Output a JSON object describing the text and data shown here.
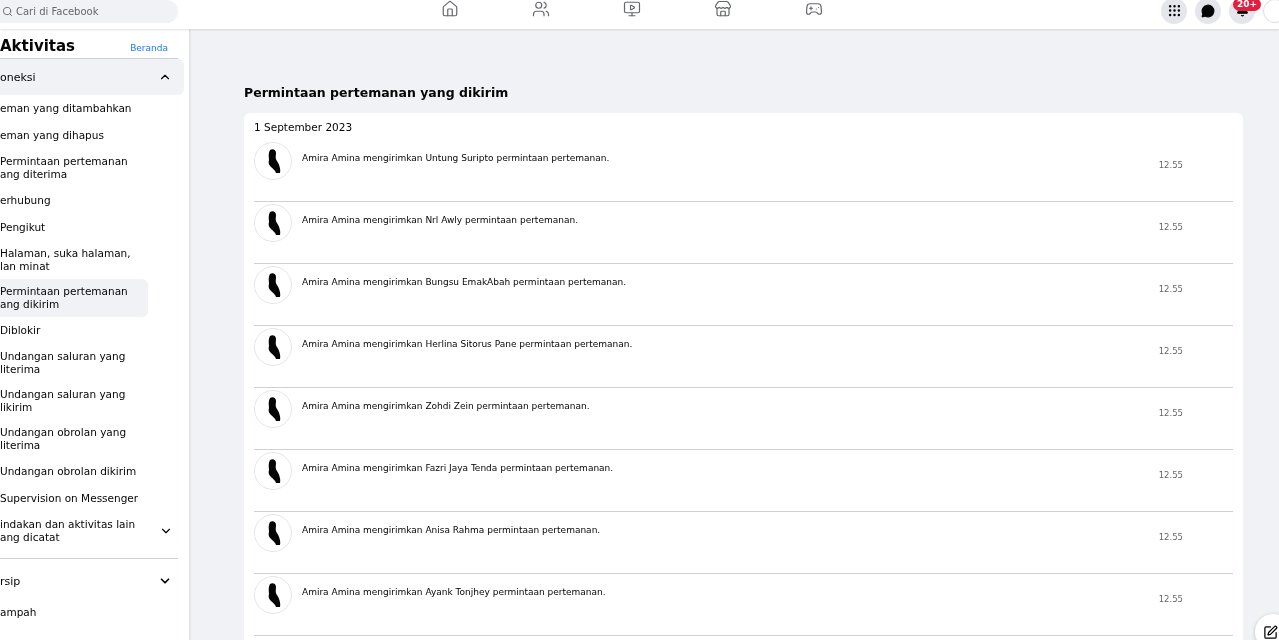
{
  "search": {
    "placeholder": "Cari di Facebook"
  },
  "nav_tabs": [
    {
      "selected": false
    },
    {
      "selected": false
    },
    {
      "selected": false
    },
    {
      "selected": false
    },
    {
      "selected": false
    }
  ],
  "notification_badge": "20+",
  "sidebar": {
    "title": "Aktivitas",
    "home_link": "Beranda",
    "section": {
      "label": "oneksi",
      "expanded": true
    },
    "items": [
      {
        "label": "eman yang ditambahkan",
        "selected": false,
        "kind": "link"
      },
      {
        "label": "eman yang dihapus",
        "selected": false,
        "kind": "link"
      },
      {
        "label": "Permintaan pertemanan\nang diterima",
        "selected": false,
        "kind": "link"
      },
      {
        "label": "erhubung",
        "selected": false,
        "kind": "link"
      },
      {
        "label": "Pengikut",
        "selected": false,
        "kind": "link"
      },
      {
        "label": "Halaman, suka halaman,\nlan minat",
        "selected": false,
        "kind": "link"
      },
      {
        "label": "Permintaan pertemanan\nang dikirim",
        "selected": true,
        "kind": "link"
      },
      {
        "label": "Diblokir",
        "selected": false,
        "kind": "link"
      },
      {
        "label": "Undangan saluran yang\nliterima",
        "selected": false,
        "kind": "link"
      },
      {
        "label": "Undangan saluran yang\nlikirim",
        "selected": false,
        "kind": "link"
      },
      {
        "label": "Undangan obrolan yang\nliterima",
        "selected": false,
        "kind": "link"
      },
      {
        "label": "Undangan obrolan dikirim",
        "selected": false,
        "kind": "link"
      },
      {
        "label": "Supervision on Messenger",
        "selected": false,
        "kind": "link"
      },
      {
        "label": "indakan dan aktivitas lain\nang dicatat",
        "selected": false,
        "kind": "group"
      }
    ],
    "archive": {
      "label": "rsip",
      "expanded": false
    },
    "trash": "ampah"
  },
  "page_title": "Permintaan pertemanan yang dikirim",
  "date": "1 September 2023",
  "rows": [
    {
      "actor": "Amira Amina",
      "verb": "mengirimkan",
      "target": "Untung Suripto",
      "rest": "permintaan pertemanan.",
      "time": "12.55"
    },
    {
      "actor": "Amira Amina",
      "verb": "mengirimkan",
      "target": "Nrl Awly",
      "rest": "permintaan pertemanan.",
      "time": "12.55"
    },
    {
      "actor": "Amira Amina",
      "verb": "mengirimkan",
      "target": "Bungsu EmakAbah",
      "rest": "permintaan pertemanan.",
      "time": "12.55"
    },
    {
      "actor": "Amira Amina",
      "verb": "mengirimkan",
      "target": "Herlina Sitorus Pane",
      "rest": "permintaan pertemanan.",
      "time": "12.55"
    },
    {
      "actor": "Amira Amina",
      "verb": "mengirimkan",
      "target": "Zohdi Zein",
      "rest": "permintaan pertemanan.",
      "time": "12.55"
    },
    {
      "actor": "Amira Amina",
      "verb": "mengirimkan",
      "target": "Fazri Jaya Tenda",
      "rest": "permintaan pertemanan.",
      "time": "12.55"
    },
    {
      "actor": "Amira Amina",
      "verb": "mengirimkan",
      "target": "Anisa Rahma",
      "rest": "permintaan pertemanan.",
      "time": "12.55"
    },
    {
      "actor": "Amira Amina",
      "verb": "mengirimkan",
      "target": "Ayank Tonjhey",
      "rest": "permintaan pertemanan.",
      "time": "12.55"
    }
  ]
}
